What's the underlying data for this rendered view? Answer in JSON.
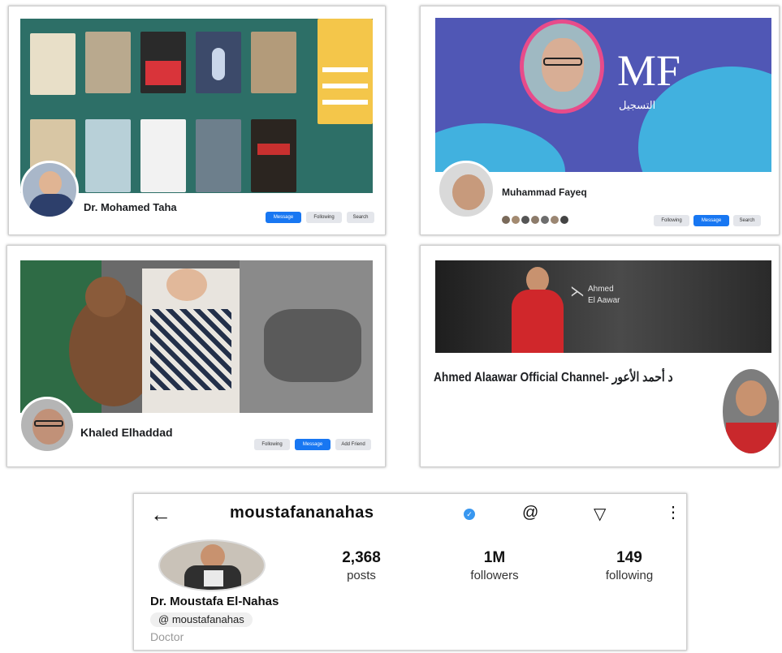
{
  "panel1": {
    "name": "Dr. Mohamed Taha",
    "subtitle": "",
    "buttons": [
      "Message",
      "Following",
      "Search"
    ],
    "book_colors": [
      "#e8dfc8",
      "#b9a98e",
      "#2a2a2a",
      "#3c4a6a",
      "#b39b7a",
      "#f4c64a",
      "#d8c6a4",
      "#b8d0d8",
      "#f2f2f2",
      "#6d7f8c",
      "#2b2520"
    ]
  },
  "panel2": {
    "name": "Muhammad Fayeq",
    "subtitle": "",
    "logo_text": "MF",
    "logo_arabic": "التسجيل",
    "buttons": [
      "Following",
      "Message",
      "Search"
    ],
    "accent_color": "#e84b8a",
    "cover_color": "#5057b5"
  },
  "panel3": {
    "name": "Khaled Elhaddad",
    "subtitle": "",
    "buttons": [
      "Following",
      "Message",
      "Add Friend"
    ]
  },
  "panel4": {
    "banner_text_1": "Ahmed",
    "banner_text_2": "El Aawar",
    "channel_title": "Ahmed Alaawar Official Channel- د أحمد الأعور",
    "handle_line": "",
    "description": "",
    "link": ""
  },
  "instagram": {
    "back_icon": "back-arrow-icon",
    "username": "moustafananahas",
    "verified_icon": "verified-badge-icon",
    "stats": [
      {
        "value": "2,368",
        "label": "posts"
      },
      {
        "value": "1M",
        "label": "followers"
      },
      {
        "value": "149",
        "label": "following"
      }
    ],
    "full_name": "Dr. Moustafa El-Nahas",
    "threads_handle": "moustafanahas",
    "category": "Doctor"
  }
}
